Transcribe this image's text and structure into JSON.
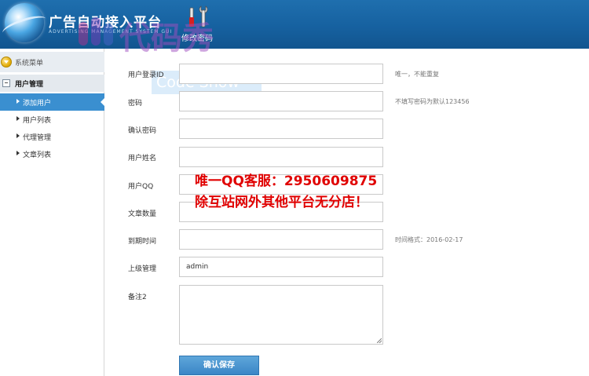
{
  "header": {
    "title": "广告自动接入平台",
    "subtitle": "ADVERTISING MANAGEMENT SYSTEM GUI",
    "change_password": "修改密码"
  },
  "watermark": {
    "brand": "代码秀",
    "label": "Code Show"
  },
  "sidebar": {
    "menu_title": "系统菜单",
    "group": "用户管理",
    "items": [
      {
        "label": "添加用户",
        "active": true
      },
      {
        "label": "用户列表",
        "active": false
      },
      {
        "label": "代理管理",
        "active": false
      },
      {
        "label": "文章列表",
        "active": false
      }
    ]
  },
  "form": {
    "fields": [
      {
        "label": "用户登录ID",
        "value": "",
        "hint": "唯一，不能重复"
      },
      {
        "label": "密码",
        "value": "",
        "hint": "不填写密码为默认123456"
      },
      {
        "label": "确认密码",
        "value": "",
        "hint": ""
      },
      {
        "label": "用户姓名",
        "value": "",
        "hint": ""
      },
      {
        "label": "用户QQ",
        "value": "",
        "hint": ""
      },
      {
        "label": "文章数量",
        "value": "",
        "hint": ""
      },
      {
        "label": "到期时间",
        "value": "",
        "hint": "时间格式：2016-02-17"
      },
      {
        "label": "上级管理",
        "value": "admin",
        "hint": ""
      }
    ],
    "remark_label": "备注2",
    "submit_label": "确认保存"
  },
  "promo": {
    "line1": "唯一QQ客服：2950609875",
    "line2": "除互站网外其他平台无分店！"
  },
  "colors": {
    "header_blue": "#1661a0",
    "active_item": "#3a8fd0",
    "promo_red": "#e00000",
    "button_blue": "#3b86c6"
  }
}
